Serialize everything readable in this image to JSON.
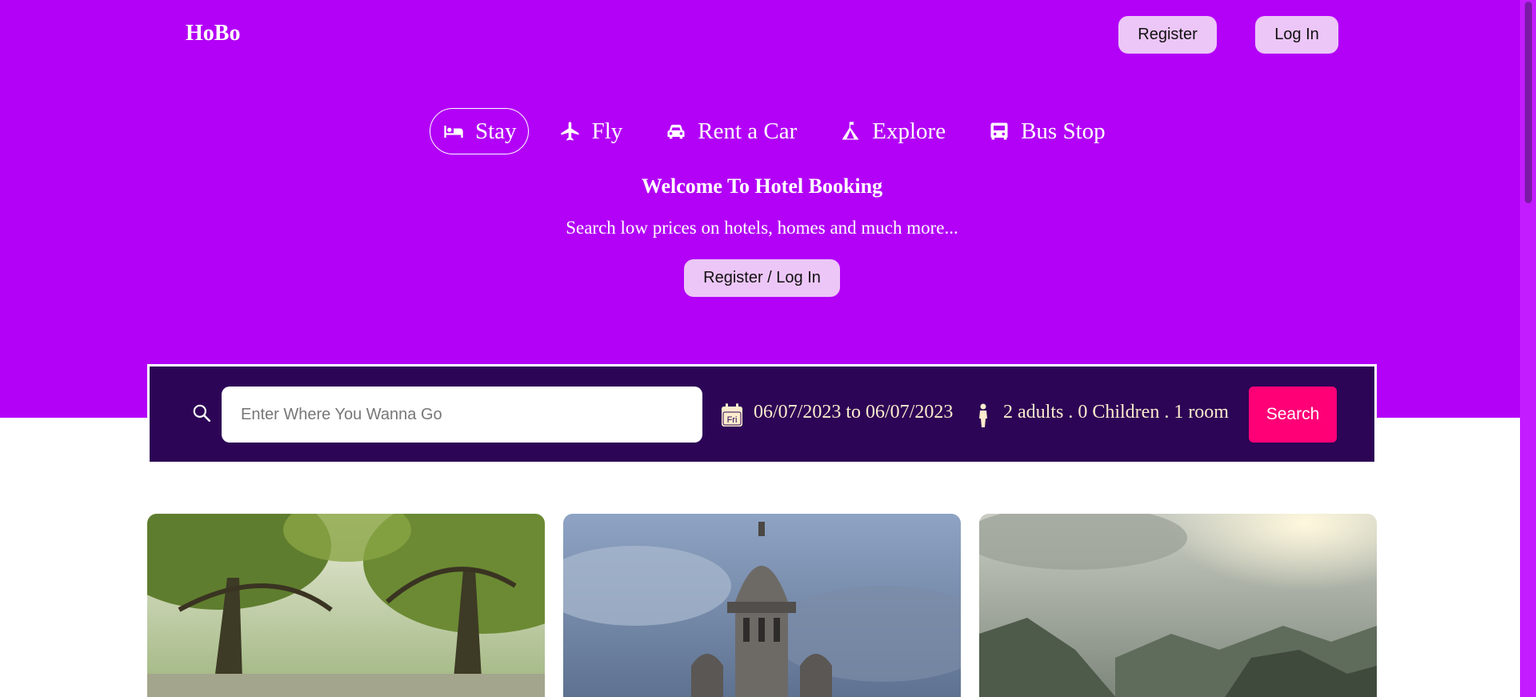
{
  "header": {
    "logo": "HoBo",
    "register_label": "Register",
    "login_label": "Log In"
  },
  "nav": {
    "items": [
      {
        "label": "Stay",
        "icon": "bed-icon",
        "active": true
      },
      {
        "label": "Fly",
        "icon": "airplane-icon",
        "active": false
      },
      {
        "label": "Rent a Car",
        "icon": "car-icon",
        "active": false
      },
      {
        "label": "Explore",
        "icon": "tent-icon",
        "active": false
      },
      {
        "label": "Bus Stop",
        "icon": "bus-icon",
        "active": false
      }
    ]
  },
  "hero": {
    "title": "Welcome To Hotel Booking",
    "subtitle": "Search low prices on hotels, homes and much more...",
    "cta_label": "Register / Log In"
  },
  "search": {
    "placeholder": "Enter Where You Wanna Go",
    "value": "",
    "calendar_day": "Fri",
    "date_range": "06/07/2023 to 06/07/2023",
    "guests": "2 adults . 0 Children . 1 room",
    "button_label": "Search"
  },
  "colors": {
    "hero_bg": "#b300f7",
    "search_bar_bg": "#2d0556",
    "search_button": "#ff0077",
    "pill_button": "#ecc6f7",
    "search_text": "#fdeccd"
  },
  "cards": [
    {
      "image": "tree-lined-street-photo"
    },
    {
      "image": "heritage-building-photo"
    },
    {
      "image": "mountain-valley-photo"
    }
  ]
}
